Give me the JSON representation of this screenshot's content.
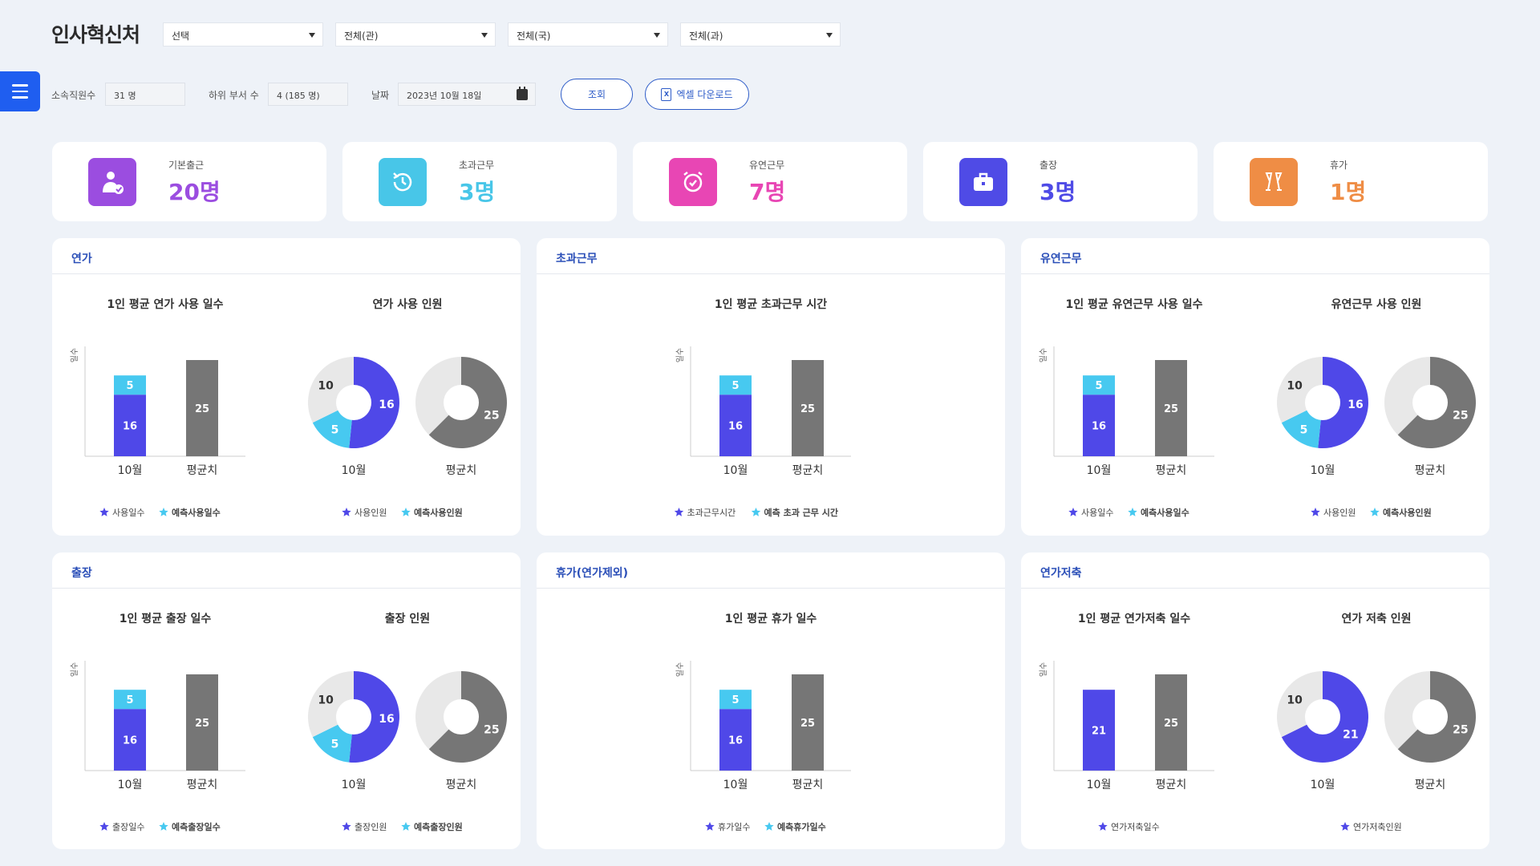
{
  "header": {
    "title": "인사혁신처",
    "selects": [
      "선택",
      "전체(관)",
      "전체(국)",
      "전체(과)"
    ]
  },
  "filters": {
    "staff_label": "소속직원수",
    "staff_value": "31 명",
    "sub_label": "하위 부서 수",
    "sub_value": "4 (185 명)",
    "date_label": "날짜",
    "date_value": "2023년 10월 18일",
    "search_label": "조회",
    "excel_label": "엑셀 다운로드"
  },
  "stats": [
    {
      "label": "기본출근",
      "value": "20명",
      "color": "#9b4de0",
      "icon": "user-check-icon"
    },
    {
      "label": "초과근무",
      "value": "3명",
      "color": "#48c6e8",
      "icon": "clock-history-icon"
    },
    {
      "label": "유연근무",
      "value": "7명",
      "color": "#e846b4",
      "icon": "alarm-clock-icon"
    },
    {
      "label": "출장",
      "value": "3명",
      "color": "#4f4be6",
      "icon": "briefcase-icon"
    },
    {
      "label": "휴가",
      "value": "1명",
      "color": "#ef8d45",
      "icon": "champagne-icon"
    }
  ],
  "colors": {
    "used": "#4f48e8",
    "predicted": "#47c9f0",
    "average": "#767676",
    "rest": "#e8e8e8"
  },
  "panels": [
    {
      "title": "연가",
      "bar": {
        "title": "1인 평균 연가 사용 일수",
        "ylabel": "일수",
        "month": "10월",
        "avg_label": "평균치",
        "used": 16,
        "predicted": 5,
        "average": 25
      },
      "pie": {
        "title": "연가 사용 인원",
        "month": "10월",
        "avg_label": "평균치",
        "used": 16,
        "predicted": 5,
        "rest": 10,
        "average": 25
      },
      "legend_bar": [
        "사용일수",
        "예측사용일수"
      ],
      "legend_pie": [
        "사용인원",
        "예측사용인원"
      ]
    },
    {
      "title": "초과근무",
      "bar": {
        "title": "1인 평균 초과근무 시간",
        "ylabel": "일수",
        "month": "10월",
        "avg_label": "평균치",
        "used": 16,
        "predicted": 5,
        "average": 25
      },
      "legend_bar": [
        "초과근무시간",
        "예측 초과 근무 시간"
      ]
    },
    {
      "title": "유연근무",
      "bar": {
        "title": "1인 평균 유연근무 사용 일수",
        "ylabel": "일수",
        "month": "10월",
        "avg_label": "평균치",
        "used": 16,
        "predicted": 5,
        "average": 25
      },
      "pie": {
        "title": "유연근무 사용 인원",
        "month": "10월",
        "avg_label": "평균치",
        "used": 16,
        "predicted": 5,
        "rest": 10,
        "average": 25
      },
      "legend_bar": [
        "사용일수",
        "예측사용일수"
      ],
      "legend_pie": [
        "사용인원",
        "예측사용인원"
      ]
    },
    {
      "title": "출장",
      "bar": {
        "title": "1인 평균 출장 일수",
        "ylabel": "일수",
        "month": "10월",
        "avg_label": "평균치",
        "used": 16,
        "predicted": 5,
        "average": 25
      },
      "pie": {
        "title": "출장 인원",
        "month": "10월",
        "avg_label": "평균치",
        "used": 16,
        "predicted": 5,
        "rest": 10,
        "average": 25
      },
      "legend_bar": [
        "출장일수",
        "예측출장일수"
      ],
      "legend_pie": [
        "출장인원",
        "예측출장인원"
      ]
    },
    {
      "title": "휴가(연가제외)",
      "bar": {
        "title": "1인 평균 휴가 일수",
        "ylabel": "일수",
        "month": "10월",
        "avg_label": "평균치",
        "used": 16,
        "predicted": 5,
        "average": 25
      },
      "legend_bar": [
        "휴가일수",
        "예측휴가일수"
      ]
    },
    {
      "title": "연가저축",
      "bar": {
        "title": "1인 평균 연가저축 일수",
        "ylabel": "일수",
        "month": "10월",
        "avg_label": "평균치",
        "used": 21,
        "predicted": 0,
        "average": 25
      },
      "pie": {
        "title": "연가 저축 인원",
        "month": "10월",
        "avg_label": "평균치",
        "used": 21,
        "predicted": 0,
        "rest": 10,
        "average": 25
      },
      "legend_bar": [
        "연가저축일수"
      ],
      "legend_pie": [
        "연가저축인원"
      ]
    }
  ],
  "chart_data": [
    {
      "type": "bar",
      "title": "1인 평균 연가 사용 일수",
      "ylabel": "일수",
      "categories": [
        "10월",
        "평균치"
      ],
      "series": [
        {
          "name": "사용일수",
          "values": [
            16,
            0
          ]
        },
        {
          "name": "예측사용일수",
          "values": [
            5,
            0
          ]
        },
        {
          "values": [
            0,
            25
          ]
        }
      ]
    },
    {
      "type": "pie",
      "title": "연가 사용 인원",
      "categories": [
        "10월",
        "평균치"
      ],
      "values": [
        [
          16,
          5,
          10
        ],
        [
          25
        ]
      ]
    },
    {
      "type": "bar",
      "title": "1인 평균 초과근무 시간",
      "ylabel": "일수",
      "categories": [
        "10월",
        "평균치"
      ],
      "series": [
        {
          "name": "초과근무시간",
          "values": [
            16,
            0
          ]
        },
        {
          "name": "예측 초과 근무 시간",
          "values": [
            5,
            0
          ]
        },
        {
          "values": [
            0,
            25
          ]
        }
      ]
    },
    {
      "type": "bar",
      "title": "1인 평균 유연근무 사용 일수",
      "ylabel": "일수",
      "categories": [
        "10월",
        "평균치"
      ],
      "series": [
        {
          "name": "사용일수",
          "values": [
            16,
            0
          ]
        },
        {
          "name": "예측사용일수",
          "values": [
            5,
            0
          ]
        },
        {
          "values": [
            0,
            25
          ]
        }
      ]
    },
    {
      "type": "pie",
      "title": "유연근무 사용 인원",
      "categories": [
        "10월",
        "평균치"
      ],
      "values": [
        [
          16,
          5,
          10
        ],
        [
          25
        ]
      ]
    },
    {
      "type": "bar",
      "title": "1인 평균 출장 일수",
      "ylabel": "일수",
      "categories": [
        "10월",
        "평균치"
      ],
      "series": [
        {
          "name": "출장일수",
          "values": [
            16,
            0
          ]
        },
        {
          "name": "예측출장일수",
          "values": [
            5,
            0
          ]
        },
        {
          "values": [
            0,
            25
          ]
        }
      ]
    },
    {
      "type": "pie",
      "title": "출장 인원",
      "categories": [
        "10월",
        "평균치"
      ],
      "values": [
        [
          16,
          5,
          10
        ],
        [
          25
        ]
      ]
    },
    {
      "type": "bar",
      "title": "1인 평균 휴가 일수",
      "ylabel": "일수",
      "categories": [
        "10월",
        "평균치"
      ],
      "series": [
        {
          "name": "휴가일수",
          "values": [
            16,
            0
          ]
        },
        {
          "name": "예측휴가일수",
          "values": [
            5,
            0
          ]
        },
        {
          "values": [
            0,
            25
          ]
        }
      ]
    },
    {
      "type": "bar",
      "title": "1인 평균 연가저축 일수",
      "ylabel": "일수",
      "categories": [
        "10월",
        "평균치"
      ],
      "series": [
        {
          "name": "연가저축일수",
          "values": [
            21,
            0
          ]
        },
        {
          "values": [
            0,
            25
          ]
        }
      ]
    },
    {
      "type": "pie",
      "title": "연가 저축 인원",
      "categories": [
        "10월",
        "평균치"
      ],
      "values": [
        [
          21,
          10
        ],
        [
          25
        ]
      ]
    }
  ]
}
